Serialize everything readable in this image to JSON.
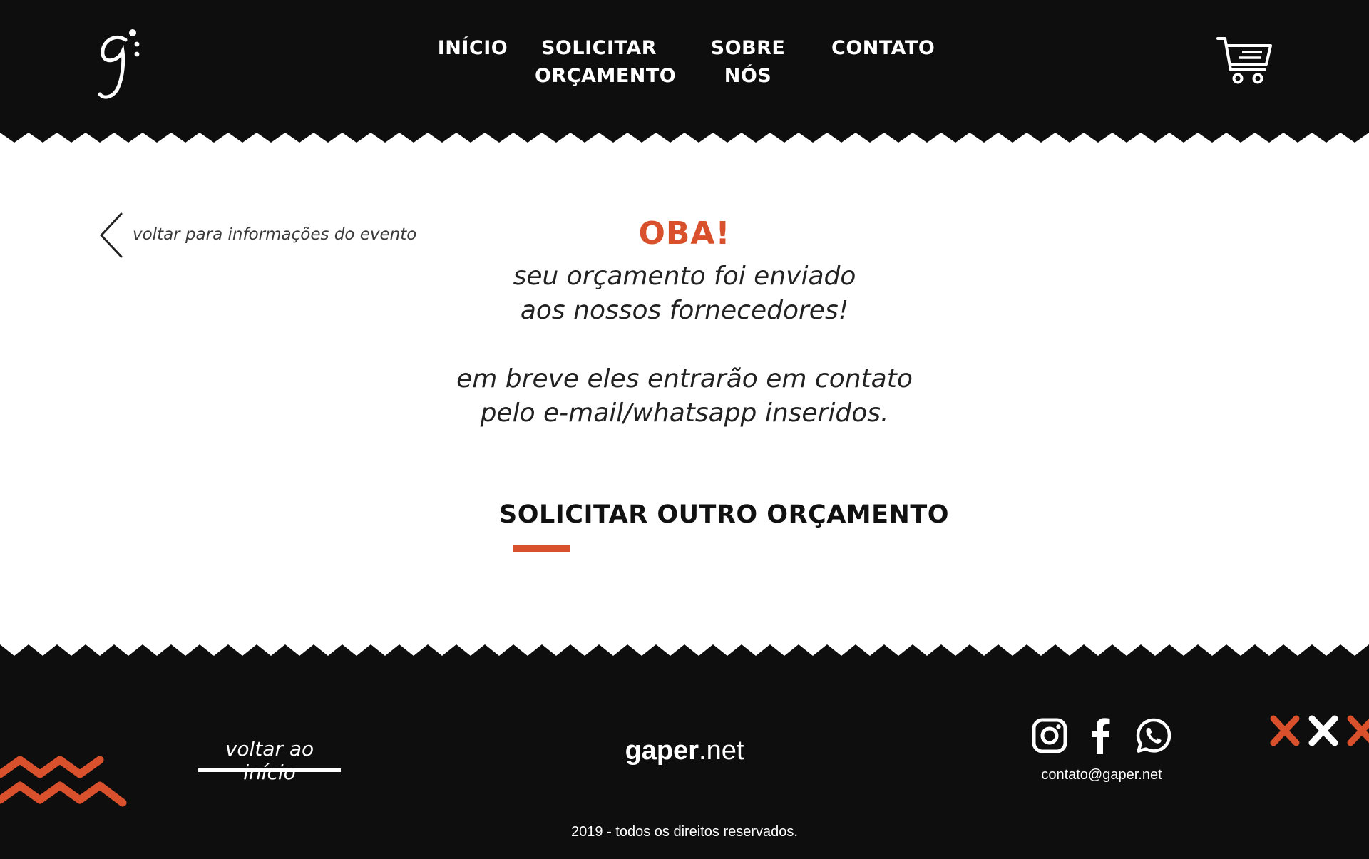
{
  "nav": {
    "items": [
      {
        "label": "INÍCIO"
      },
      {
        "label": "SOLICITAR ORÇAMENTO"
      },
      {
        "label": "SOBRE NÓS"
      },
      {
        "label": "CONTATO"
      }
    ]
  },
  "icons": {
    "logo": "gaper-logo",
    "cart": "cart-icon",
    "back": "chevron-left-icon",
    "social": [
      "instagram-icon",
      "facebook-icon",
      "whatsapp-icon"
    ]
  },
  "main": {
    "back_link": "voltar para informações do evento",
    "headline": "OBA!",
    "message_lines": [
      "seu orçamento foi enviado",
      "aos nossos fornecedores!",
      "em breve eles entrarão em contato",
      "pelo e-mail/whatsapp inseridos."
    ],
    "cta": "SOLICITAR OUTRO ORÇAMENTO"
  },
  "footer": {
    "home_link": "voltar ao início",
    "brand_bold": "gaper",
    "brand_rest": ".net",
    "email": "contato@gaper.net",
    "copyright": "2019 - todos os direitos reservados."
  },
  "colors": {
    "background_dark": "#0e0e0e",
    "accent": "#d9512c",
    "text_light": "#ffffff",
    "text_dark": "#222222"
  }
}
